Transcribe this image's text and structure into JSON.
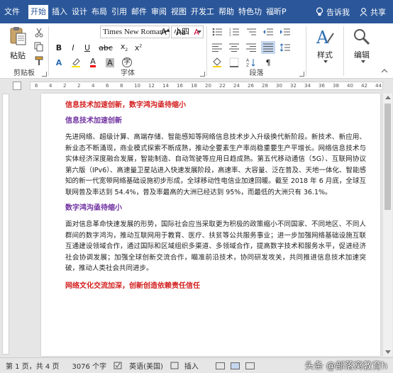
{
  "tabs": [
    "文件",
    "开始",
    "插入",
    "设计",
    "布局",
    "引用",
    "邮件",
    "审阅",
    "视图",
    "开发工",
    "帮助",
    "特色功",
    "福昕P"
  ],
  "selected_tab": "开始",
  "tell_me": "告诉我",
  "share": "共享",
  "ribbon": {
    "clipboard": {
      "paste": "粘贴",
      "label": "剪贴板"
    },
    "font": {
      "name": "Times New Roman",
      "size": "小四",
      "label": "字体",
      "bold": "B",
      "italic": "I",
      "underline": "U",
      "clear": "A"
    },
    "paragraph": {
      "label": "段落"
    },
    "styles": {
      "label": "样式"
    },
    "editing": {
      "label": "编辑"
    }
  },
  "ruler_numbers": [
    "6",
    "4",
    "2",
    "2",
    "4",
    "6",
    "8",
    "10",
    "12",
    "14",
    "16",
    "18",
    "20",
    "22",
    "24",
    "26",
    "28",
    "30",
    "32",
    "34",
    "36",
    "38",
    "40",
    "42",
    "44"
  ],
  "document": {
    "heading1": "信息技术加速创新，数字鸿沟亟待缩小",
    "sub1": "信息技术加速创新",
    "para1": "先进网络、超级计算、高端存储、智能感知等网络信息技术步入升级换代新阶段。新技术、新应用、新业态不断涌现，商业模式探索不断成熟，推动全要素生产率尚稳重要生产平增长。网络信息技术与实体经济深度融合发展，智能制造、自动驾驶等应用日趋成熟。第五代移动通信（5G）、互联网协议第六版（IPv6）、高速量卫星站进入快速发展阶段，高速率、大容量、泛在普及、天地一体化、智能感知的新一代宽带网络基础设施初步形成，全球移动性电信业加速回暖。截至 2018 年 6 月底，全球互联网普及率达到 54.4%，普及率最高的大洲已经达到 95%，而最低的大洲只有 36.1%。",
    "sub2": "数字鸿沟亟待缩小",
    "para2": "面对信息革命快速发展的形势，国际社会应当采取更为积极的政策缩小不同国家、不同地区、不同人群间的数字鸿沟，推动互联网用于教育、医疗、扶贫等公共服务事业；进一步加强网络基础设施互联互通建设领域合作，通过国际和区域组织多渠道、多领域合作，提高数字技术和服务水平，促进经济社会协调发展；加强全球创新交流合作，瞄准前沿技术，协同研发攻关，共同推进信息技术加速突破，推动人类社会共同进步。",
    "heading2": "网络文化交流加深，创新创造依赖责任信任"
  },
  "status": {
    "page": "第 1 页，共 4 页",
    "words": "3076 个字",
    "lang": "英语(美国)",
    "insert": "插入"
  },
  "watermark": "头条 @部落窝教育h"
}
